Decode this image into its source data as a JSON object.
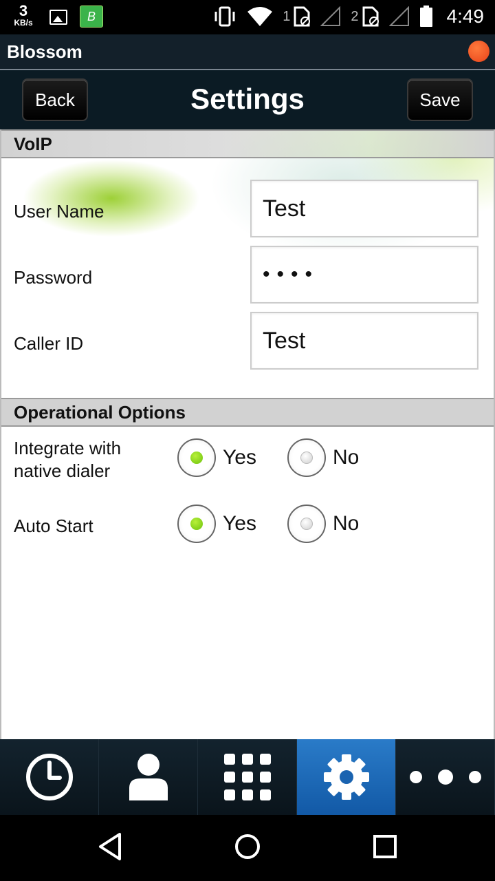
{
  "status_bar": {
    "speed_value": "3",
    "speed_unit": "KB/s",
    "app_icon_text": "B",
    "sim1": "1",
    "sim2": "2",
    "time": "4:49"
  },
  "app": {
    "title": "Blossom",
    "indicator_color": "#e8431a"
  },
  "nav": {
    "back_label": "Back",
    "title": "Settings",
    "save_label": "Save"
  },
  "voip": {
    "header": "VoIP",
    "user_name_label": "User Name",
    "user_name_value": "Test",
    "password_label": "Password",
    "password_value": "••••",
    "caller_id_label": "Caller ID",
    "caller_id_value": "Test"
  },
  "operational": {
    "header": "Operational Options",
    "integrate_label": "Integrate with native dialer",
    "integrate_selected": "Yes",
    "auto_start_label": "Auto Start",
    "auto_start_selected": "Yes",
    "yes_label": "Yes",
    "no_label": "No",
    "selected_color": "#7ccd14"
  },
  "tabs": [
    {
      "name": "recents",
      "icon": "clock-icon"
    },
    {
      "name": "contacts",
      "icon": "person-icon"
    },
    {
      "name": "dialpad",
      "icon": "keypad-icon"
    },
    {
      "name": "settings",
      "icon": "gear-icon",
      "active": true
    },
    {
      "name": "more",
      "icon": "more-icon"
    }
  ],
  "colors": {
    "active_tab": "#1f6bb8",
    "title_bar": "#13202a"
  }
}
